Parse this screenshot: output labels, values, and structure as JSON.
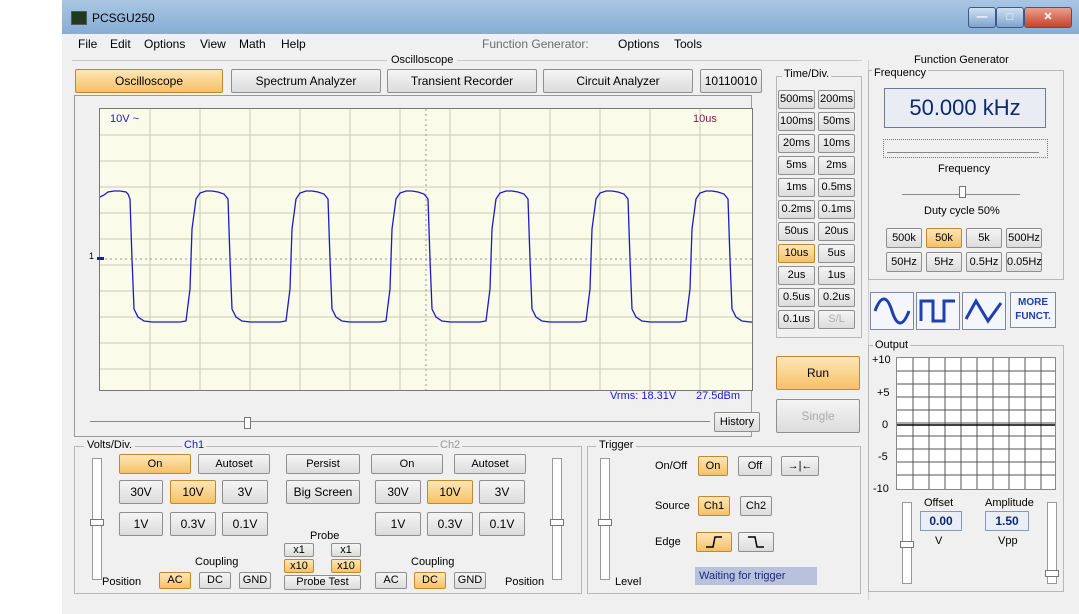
{
  "window": {
    "title": "PCSGU250"
  },
  "menu": {
    "items": [
      "File",
      "Edit",
      "Options",
      "View",
      "Math",
      "Help"
    ],
    "fg_label": "Function Generator:",
    "fg_items": [
      "Options",
      "Tools"
    ]
  },
  "oscilloscope": {
    "group_label": "Oscilloscope",
    "tabs": [
      "Oscilloscope",
      "Spectrum Analyzer",
      "Transient Recorder",
      "Circuit Analyzer",
      "10110010"
    ],
    "screen": {
      "ch1_scale": "10V ~",
      "timebase": "10us",
      "marker": "1",
      "vrms": "Vrms: 18.31V",
      "dbm": "27.5dBm"
    },
    "history_label": "History"
  },
  "timediv": {
    "label": "Time/Div.",
    "left": [
      "500ms",
      "100ms",
      "20ms",
      "5ms",
      "1ms",
      "0.2ms",
      "50us",
      "10us",
      "2us",
      "0.5us",
      "0.1us"
    ],
    "right": [
      "200ms",
      "50ms",
      "10ms",
      "2ms",
      "0.5ms",
      "0.1ms",
      "20us",
      "5us",
      "1us",
      "0.2us",
      "S/L"
    ],
    "selected": "10us",
    "run_label": "Run",
    "single_label": "Single"
  },
  "voltsdiv": {
    "label": "Volts/Div.",
    "ch1_label": "Ch1",
    "ch2_label": "Ch2",
    "ch1": {
      "on": "On",
      "autoset": "Autoset",
      "ranges": [
        "30V",
        "10V",
        "3V",
        "1V",
        "0.3V",
        "0.1V"
      ],
      "selected": "10V"
    },
    "persist": "Persist",
    "big_screen": "Big Screen",
    "ch2": {
      "on": "On",
      "autoset": "Autoset",
      "ranges": [
        "30V",
        "10V",
        "3V",
        "1V",
        "0.3V",
        "0.1V"
      ],
      "selected": "10V"
    },
    "probe_label": "Probe",
    "probe_x1": "x1",
    "probe_x10": "x10",
    "probe_test": "Probe Test",
    "coupling_label": "Coupling",
    "coupling": [
      "AC",
      "DC",
      "GND"
    ],
    "ch1_coupling_selected": "AC",
    "ch2_coupling_selected": "DC",
    "position_label": "Position"
  },
  "trigger": {
    "label": "Trigger",
    "onoff_label": "On/Off",
    "on": "On",
    "off": "Off",
    "source_label": "Source",
    "ch1": "Ch1",
    "ch2": "Ch2",
    "edge_label": "Edge",
    "level_label": "Level",
    "status": "Waiting for trigger"
  },
  "function_generator": {
    "label": "Function Generator",
    "frequency_group": "Frequency",
    "frequency_value": "50.000 kHz",
    "frequency_slider_label": "Frequency",
    "duty_label": "Duty cycle 50%",
    "ranges": [
      "500k",
      "50k",
      "5k",
      "500Hz",
      "50Hz",
      "5Hz",
      "0.5Hz",
      "0.05Hz"
    ],
    "selected_range": "50k",
    "more": "MORE FUNCT.",
    "output_label": "Output",
    "y_ticks": [
      "+10",
      "+5",
      "0",
      "-5",
      "-10"
    ],
    "offset_label": "Offset",
    "offset_value": "0.00",
    "offset_unit": "V",
    "amplitude_label": "Amplitude",
    "amplitude_value": "1.50",
    "amplitude_unit": "Vpp"
  },
  "colors": {
    "trace": "#1a1acc",
    "accent_orange": "#f6c167",
    "screen_bg": "#fbfbe9",
    "fg_display": "#0b2a70"
  }
}
